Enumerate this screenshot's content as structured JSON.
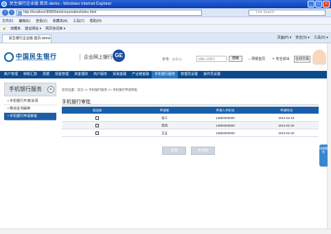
{
  "window": {
    "title": "民生银行企业版 首页-demo - Windows Internet Explorer"
  },
  "address": {
    "url": "http://localhost:8080/html/corporation/index.html",
    "search_placeholder": "Live Search"
  },
  "menu": [
    "文件(F)",
    "编辑(E)",
    "查看(V)",
    "收藏夹(A)",
    "工具(T)",
    "帮助(H)"
  ],
  "favorites": {
    "label": "收藏夹",
    "items": [
      "建议网站 ▾",
      "网页快讯库 ▾"
    ]
  },
  "tab": {
    "title": "民生银行企业版 首页-demo"
  },
  "tools": [
    "页面(P) ▾",
    "安全(S) ▾",
    "工具(O) ▾"
  ],
  "header": {
    "logo_cn": "中国民生银行",
    "logo_en": "CHINA MINSHENG BANKING CORP. LTD",
    "site_title": "企业网上银行",
    "school_label": "学号:",
    "school_value": "大中小",
    "search_placeholder": "请输入关键字",
    "search_button": "搜索",
    "home": "网银首页",
    "safe_exit": "安全退出",
    "login": "在线交易",
    "ge": "GE"
  },
  "nav": [
    "账户管理",
    "转账汇款",
    "票据",
    "现金管理",
    "资金理财",
    "商户服务",
    "贸易金融",
    "产业链金融",
    "手机银行服务",
    "管理员设置",
    "操作员设置"
  ],
  "nav_active": "手机银行服务",
  "sidebar": {
    "title": "手机银行服务",
    "items": [
      "手机银行开通/关闭",
      "移动证书解绑",
      "手机银行申请审批"
    ],
    "active": "手机银行申请审批"
  },
  "content": {
    "breadcrumb": "您的位置：首页 >> 手机银行服务 >> 手机银行申请审批",
    "title": "手机银行审批",
    "columns": [
      "请选择",
      "申请者",
      "申请人手机号",
      "申请时间"
    ],
    "rows": [
      {
        "name": "张三",
        "phone": "13800000000",
        "time": "2013-02-18"
      },
      {
        "name": "李四",
        "phone": "13800000000",
        "time": "2013-02-20"
      },
      {
        "name": "王五",
        "phone": "13800000000",
        "time": "2013-02-20"
      }
    ],
    "approve": "同意",
    "reject": "不同意"
  },
  "sidetab": "快速服务"
}
